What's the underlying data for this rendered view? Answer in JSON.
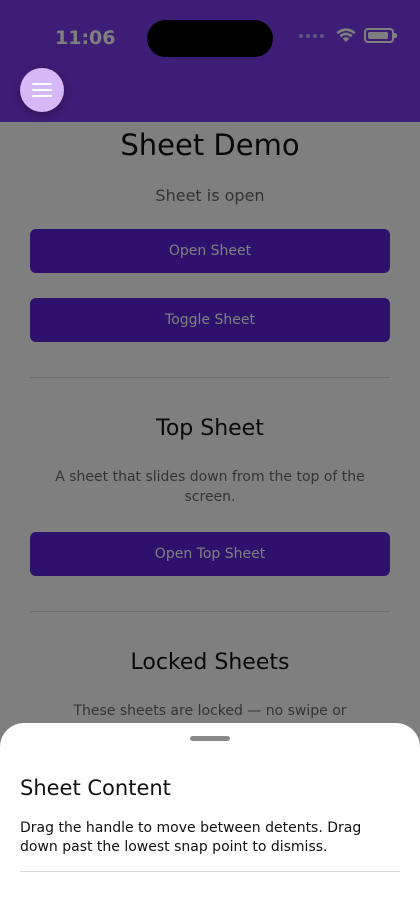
{
  "status_bar": {
    "time": "11:06"
  },
  "header": {
    "menu_icon": "hamburger-menu-icon"
  },
  "main": {
    "title": "Sheet Demo",
    "status_text": "Sheet is open",
    "open_sheet_label": "Open Sheet",
    "toggle_sheet_label": "Toggle Sheet",
    "top_sheet": {
      "title": "Top Sheet",
      "description": "A sheet that slides down from the top of the screen.",
      "button_label": "Open Top Sheet"
    },
    "locked_sheets": {
      "title": "Locked Sheets",
      "description": "These sheets are locked — no swipe or backdrop dismiss. Only controls inside can close them."
    }
  },
  "sheet": {
    "title": "Sheet Content",
    "text": "Drag the handle to move between detents. Drag down past the lowest snap point to dismiss."
  },
  "colors": {
    "header_bg": "#7c3aed",
    "button_bg": "#5a23d8",
    "menu_button_bg": "#d7b8f6"
  }
}
